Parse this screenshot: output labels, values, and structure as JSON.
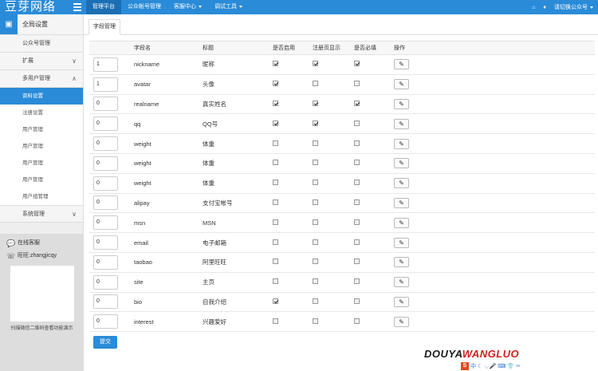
{
  "app": {
    "logo": "豆芽网络"
  },
  "topnav": [
    {
      "label": "管理平台",
      "active": true,
      "caret": false
    },
    {
      "label": "公众帐号管理",
      "active": false,
      "caret": false
    },
    {
      "label": "客服中心",
      "active": false,
      "caret": true
    },
    {
      "label": "调试工具",
      "active": false,
      "caret": true
    }
  ],
  "topright": {
    "user_label": "请切换公众号"
  },
  "sidebar": {
    "head": "全局设置",
    "items": [
      {
        "label": "公众号管理",
        "chev": ""
      },
      {
        "label": "扩展",
        "chev": "∨"
      },
      {
        "label": "多用户管理",
        "chev": "∧"
      }
    ],
    "subitems": [
      "资料设置",
      "注册设置",
      "用户管理",
      "用户管理",
      "用户管理",
      "用户管理",
      "用户组管理"
    ],
    "system": {
      "label": "系统管理",
      "chev": "∨"
    }
  },
  "service": {
    "online": "在线客服",
    "wangwang": "旺旺:zhangjicqy",
    "caption": "扫描微信二维码查看功能演示"
  },
  "tab": {
    "label": "字段管理"
  },
  "table": {
    "headers": [
      "",
      "字段名",
      "标题",
      "是否启用",
      "注册页显示",
      "是否必填",
      "操作"
    ],
    "rows": [
      {
        "order": "1",
        "field": "nickname",
        "title": "昵称",
        "enabled": true,
        "show": true,
        "required": true
      },
      {
        "order": "1",
        "field": "avatar",
        "title": "头像",
        "enabled": true,
        "show": false,
        "required": false
      },
      {
        "order": "0",
        "field": "realname",
        "title": "真实姓名",
        "enabled": true,
        "show": true,
        "required": true
      },
      {
        "order": "0",
        "field": "qq",
        "title": "QQ号",
        "enabled": true,
        "show": true,
        "required": false
      },
      {
        "order": "0",
        "field": "weight",
        "title": "体重",
        "enabled": false,
        "show": false,
        "required": false
      },
      {
        "order": "0",
        "field": "weight",
        "title": "体重",
        "enabled": false,
        "show": false,
        "required": false
      },
      {
        "order": "0",
        "field": "weight",
        "title": "体重",
        "enabled": false,
        "show": false,
        "required": false
      },
      {
        "order": "0",
        "field": "alipay",
        "title": "支付宝帐号",
        "enabled": false,
        "show": false,
        "required": false
      },
      {
        "order": "0",
        "field": "msn",
        "title": "MSN",
        "enabled": false,
        "show": false,
        "required": false
      },
      {
        "order": "0",
        "field": "email",
        "title": "电子邮箱",
        "enabled": false,
        "show": false,
        "required": false
      },
      {
        "order": "0",
        "field": "taobao",
        "title": "阿里旺旺",
        "enabled": false,
        "show": false,
        "required": false
      },
      {
        "order": "0",
        "field": "site",
        "title": "主页",
        "enabled": false,
        "show": false,
        "required": false
      },
      {
        "order": "0",
        "field": "bio",
        "title": "自我介绍",
        "enabled": true,
        "show": false,
        "required": false
      },
      {
        "order": "0",
        "field": "interest",
        "title": "兴趣爱好",
        "enabled": false,
        "show": false,
        "required": false
      }
    ]
  },
  "submit_label": "提交",
  "watermark": {
    "part1": "DOUYA",
    "part2": "WANGLUO"
  },
  "ime": {
    "badge": "S",
    "label": "中"
  },
  "colors": {
    "primary": "#2a8bd8",
    "active_nav": "#1c6fb4"
  }
}
